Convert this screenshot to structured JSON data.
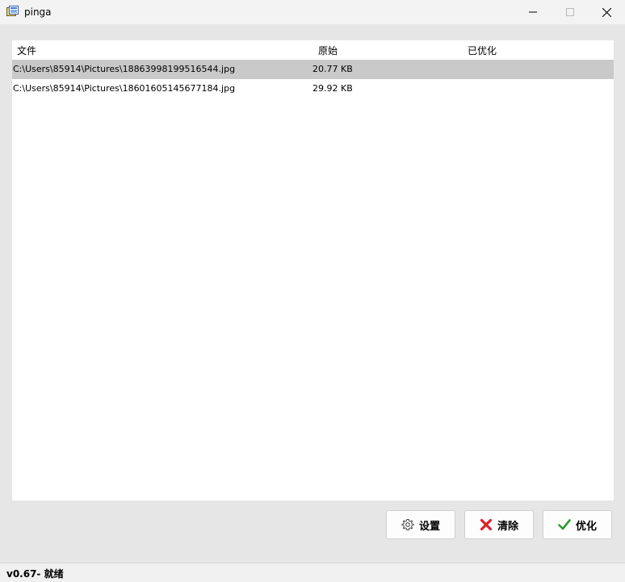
{
  "window": {
    "title": "pinga"
  },
  "table": {
    "columns": [
      "文件",
      "原始",
      "已优化"
    ],
    "rows": [
      {
        "file": "C:\\Users\\85914\\Pictures\\18863998199516544.jpg",
        "original": "20.77 KB",
        "optimized": "",
        "selected": true
      },
      {
        "file": "C:\\Users\\85914\\Pictures\\18601605145677184.jpg",
        "original": "29.92 KB",
        "optimized": "",
        "selected": false
      }
    ]
  },
  "buttons": {
    "settings": "设置",
    "clear": "清除",
    "optimize": "优化"
  },
  "status": {
    "text": "v0.67- 就绪"
  },
  "colors": {
    "selected_row": "#c9c9c9",
    "clear_icon": "#e0202a",
    "optimize_icon": "#2e9a2e"
  },
  "icons": {
    "app": "app-image-icon",
    "minimize": "minimize-icon",
    "maximize": "maximize-icon",
    "close": "close-icon",
    "settings": "gear-icon",
    "clear": "red-x-icon",
    "optimize": "green-check-icon"
  }
}
